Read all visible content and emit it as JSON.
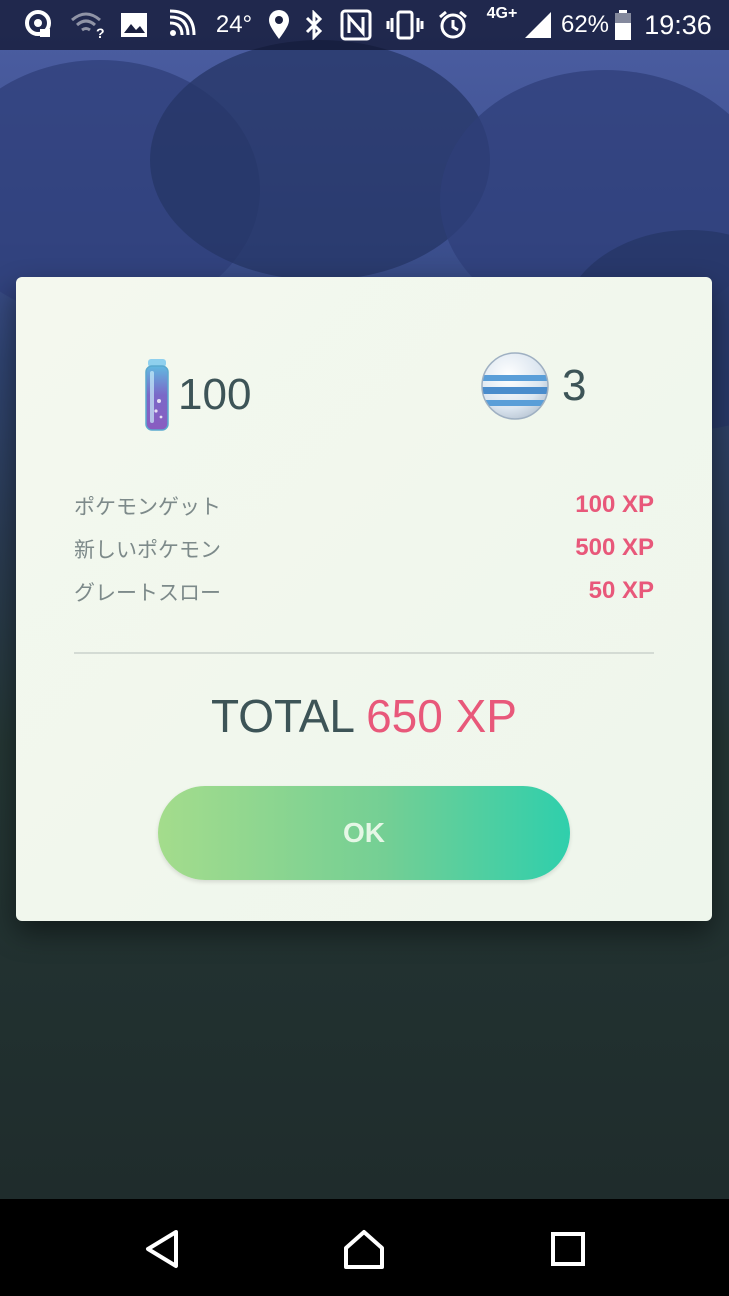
{
  "status_bar": {
    "temperature": "24°",
    "network": "4G+",
    "battery": "62%",
    "time": "19:36",
    "icons": [
      "app-notification-icon",
      "wifi-icon",
      "image-icon",
      "nfc-signal-icon",
      "location-icon",
      "bluetooth-icon",
      "nfc-icon",
      "vibrate-icon",
      "alarm-icon",
      "cell-signal-icon",
      "battery-icon"
    ]
  },
  "dialog": {
    "rewards": {
      "stardust_amount": "100",
      "candy_amount": "3"
    },
    "xp_rows": [
      {
        "label": "ポケモンゲット",
        "value": "100 XP"
      },
      {
        "label": "新しいポケモン",
        "value": "500 XP"
      },
      {
        "label": "グレートスロー",
        "value": "50 XP"
      }
    ],
    "total_label": "TOTAL",
    "total_value": "650 XP",
    "ok_label": "OK"
  },
  "nav_bar": {
    "icons": [
      "back-icon",
      "home-icon",
      "recents-icon"
    ]
  },
  "colors": {
    "xp_accent": "#e8587a",
    "text_dark": "#3d5457",
    "ok_gradient_start": "#a4dc8c",
    "ok_gradient_end": "#2fcfac"
  }
}
